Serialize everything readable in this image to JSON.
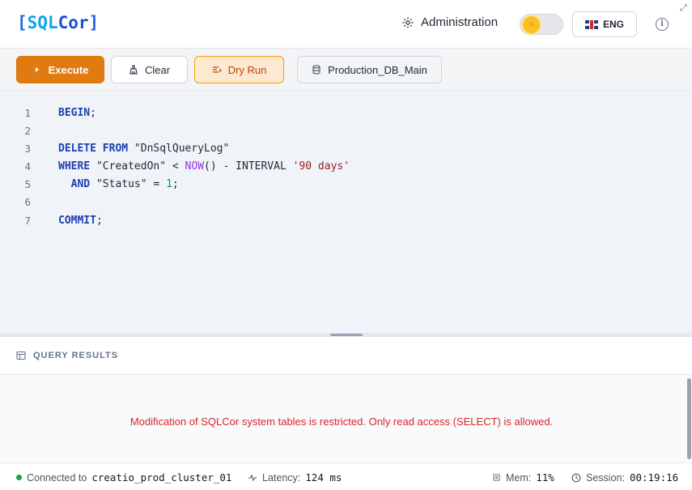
{
  "app": {
    "logo_open": "[",
    "logo_sql": "SQL",
    "logo_rest": "Cor",
    "logo_close": "]"
  },
  "header": {
    "admin_label": "Administration",
    "lang_label": "ENG",
    "info_glyph": "i"
  },
  "toolbar": {
    "execute_label": "Execute",
    "clear_label": "Clear",
    "dry_run_label": "Dry Run",
    "database_label": "Production_DB_Main"
  },
  "editor": {
    "line_numbers": [
      "1",
      "2",
      "3",
      "4",
      "5",
      "6",
      "7"
    ]
  },
  "results": {
    "heading": "QUERY RESULTS",
    "error_message": "Modification of SQLCor system tables is restricted. Only read access (SELECT) is allowed."
  },
  "status": {
    "connected_prefix": "Connected to",
    "cluster": "creatio_prod_cluster_01",
    "latency_label": "Latency:",
    "latency_value": "124 ms",
    "mem_label": "Mem:",
    "mem_value": "11%",
    "session_label": "Session:",
    "session_value": "00:19:16"
  },
  "colors": {
    "accent": "#e07b12",
    "error": "#dc2626",
    "connected": "#16a34a",
    "keyword": "#1e40af"
  },
  "icons": {
    "admin": "gear-icon",
    "theme": "sun-icon",
    "language": "uk-flag-icon",
    "info": "info-icon",
    "execute": "play-icon",
    "clear": "broom-icon",
    "dry_run": "filter-lines-icon",
    "database": "database-icon",
    "results": "table-icon",
    "latency": "pulse-icon",
    "memory": "chip-icon",
    "session": "clock-icon"
  }
}
